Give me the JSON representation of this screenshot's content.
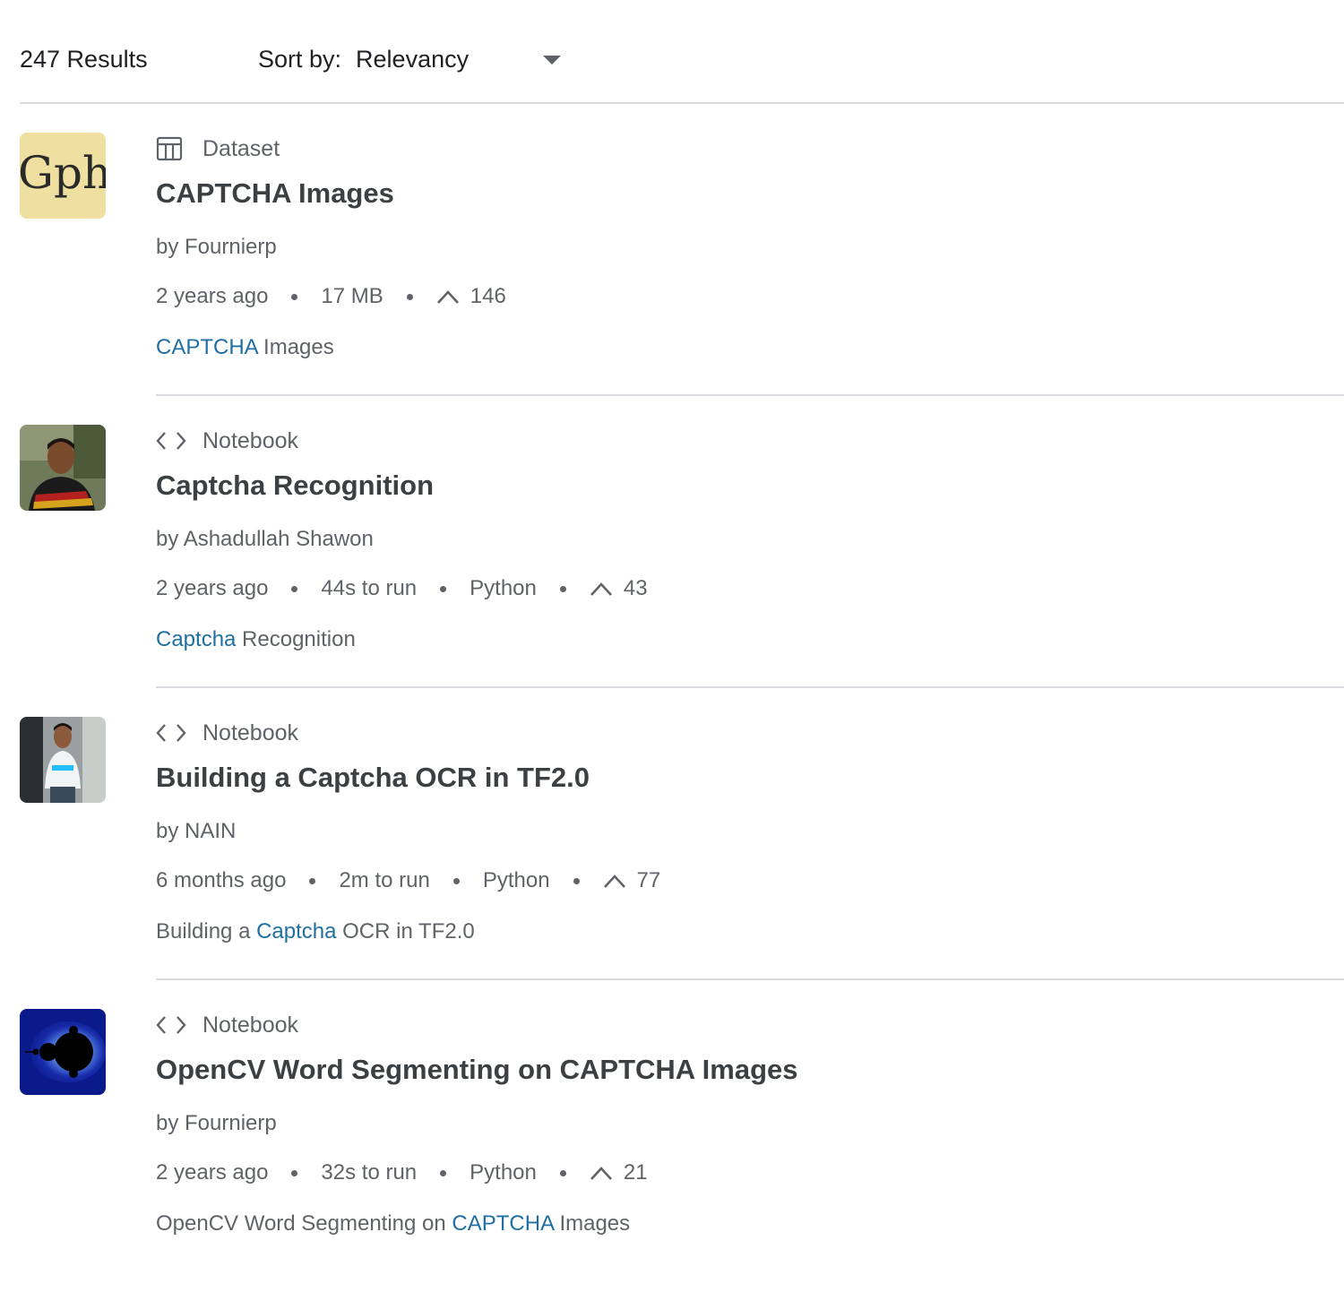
{
  "toolbar": {
    "results_count": "247 Results",
    "sort_label": "Sort by:",
    "sort_value": "Relevancy"
  },
  "results": [
    {
      "type_label": "Dataset",
      "type_icon": "table-icon",
      "thumbnail": "captcha-text-thumbnail",
      "title": "CAPTCHA Images",
      "author": "by Fournierp",
      "meta": [
        "2 years ago",
        "17 MB"
      ],
      "votes": "146",
      "snippet_pre": "",
      "snippet_hl": "CAPTCHA",
      "snippet_post": " Images"
    },
    {
      "type_label": "Notebook",
      "type_icon": "code-icon",
      "thumbnail": "user-avatar-shawon",
      "title": "Captcha Recognition",
      "author": "by Ashadullah Shawon",
      "meta": [
        "2 years ago",
        "44s to run",
        "Python"
      ],
      "votes": "43",
      "snippet_pre": "",
      "snippet_hl": "Captcha",
      "snippet_post": " Recognition"
    },
    {
      "type_label": "Notebook",
      "type_icon": "code-icon",
      "thumbnail": "user-avatar-nain",
      "title": "Building a Captcha OCR in TF2.0",
      "author": "by NAIN",
      "meta": [
        "6 months ago",
        "2m to run",
        "Python"
      ],
      "votes": "77",
      "snippet_pre": "Building a ",
      "snippet_hl": "Captcha",
      "snippet_post": " OCR in TF2.0"
    },
    {
      "type_label": "Notebook",
      "type_icon": "code-icon",
      "thumbnail": "mandelbrot-thumbnail",
      "title": "OpenCV Word Segmenting on CAPTCHA Images",
      "author": "by Fournierp",
      "meta": [
        "2 years ago",
        "32s to run",
        "Python"
      ],
      "votes": "21",
      "snippet_pre": "OpenCV Word Segmenting on ",
      "snippet_hl": "CAPTCHA",
      "snippet_post": " Images"
    }
  ],
  "thumb_text": "Gph",
  "colors": {
    "highlight": "#1f6fa3",
    "muted_text": "#5f6368",
    "title_text": "#3c4043",
    "divider": "#dadce0"
  }
}
